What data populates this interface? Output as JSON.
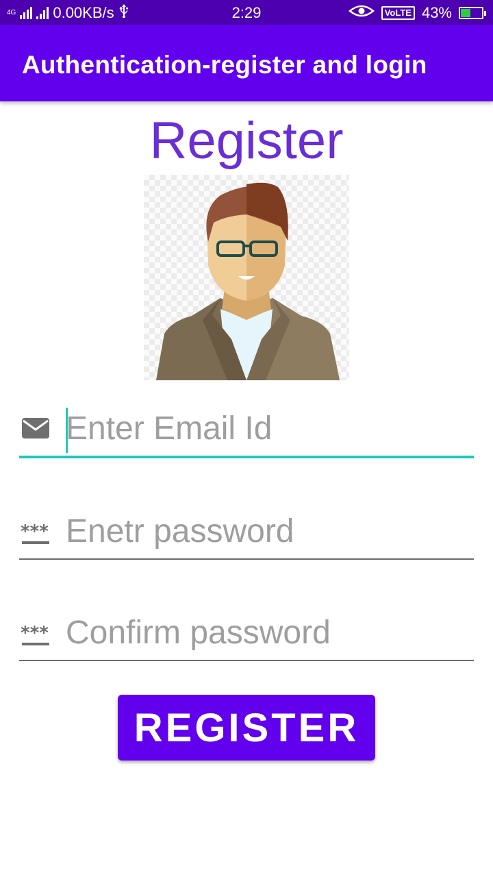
{
  "status_bar": {
    "network_tag": "4G",
    "speed": "0.00KB/s",
    "time": "2:29",
    "volte": "VoLTE",
    "battery": "43%",
    "battery_level": 0.43,
    "icons": [
      "signal-icon",
      "signal-icon",
      "usb-icon",
      "eye-icon",
      "battery-icon"
    ]
  },
  "app_bar": {
    "title": "Authentication-register and login",
    "color": "#6200ee"
  },
  "page": {
    "title": "Register",
    "title_color": "#6a2ed6"
  },
  "form": {
    "email_placeholder": "Enter Email Id",
    "email_icon": "email-icon",
    "password_placeholder": "Enetr password",
    "password_icon": "password-icon",
    "confirm_placeholder": "Confirm password",
    "confirm_icon": "password-icon",
    "accent_color": "#1fc8c0"
  },
  "register_button": {
    "label": "REGISTER",
    "color": "#6200ee"
  }
}
